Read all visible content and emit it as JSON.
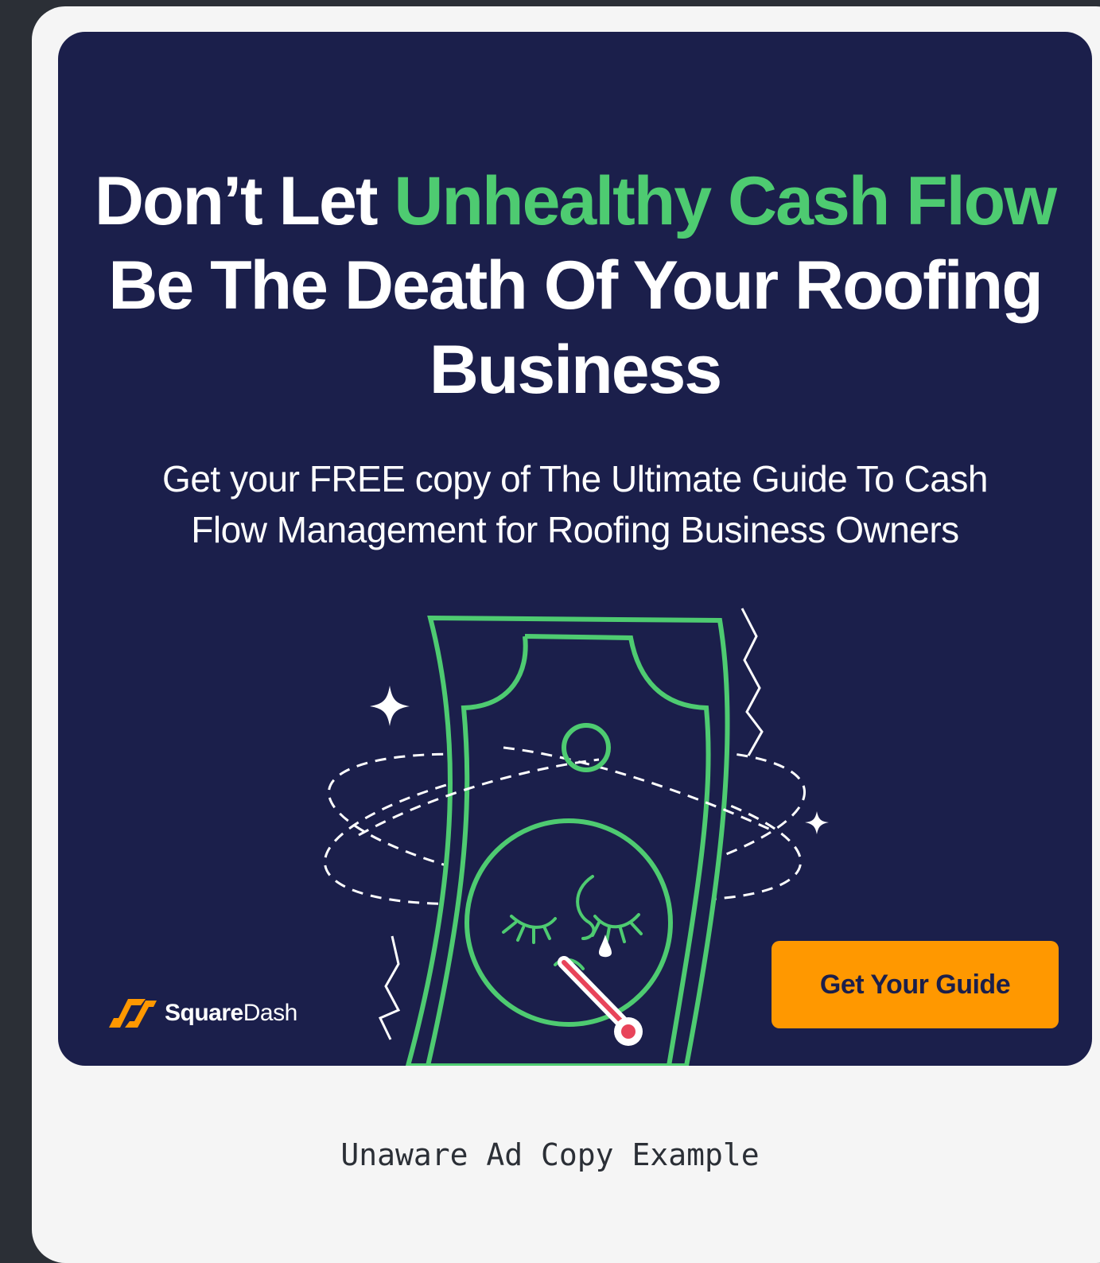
{
  "ad": {
    "headline": {
      "part1": "Don’t Let ",
      "accent": "Unhealthy Cash Flow",
      "part2": " Be The Death Of Your Roofing Business"
    },
    "subheadline": "Get your FREE copy of The Ultimate Guide To Cash Flow Management for Roofing Business Owners",
    "cta_label": "Get Your Guide",
    "logo": {
      "bold": "Square",
      "regular": "Dash"
    },
    "illustration_icon": "sick-dollar-bill-icon"
  },
  "caption": "Unaware Ad Copy Example",
  "colors": {
    "page_background": "#2b2f36",
    "card_background": "#f5f5f5",
    "ad_background": "#1b1f4b",
    "accent_green": "#4ecb71",
    "cta_orange": "#ff9800",
    "thermometer_red": "#e8445a"
  }
}
